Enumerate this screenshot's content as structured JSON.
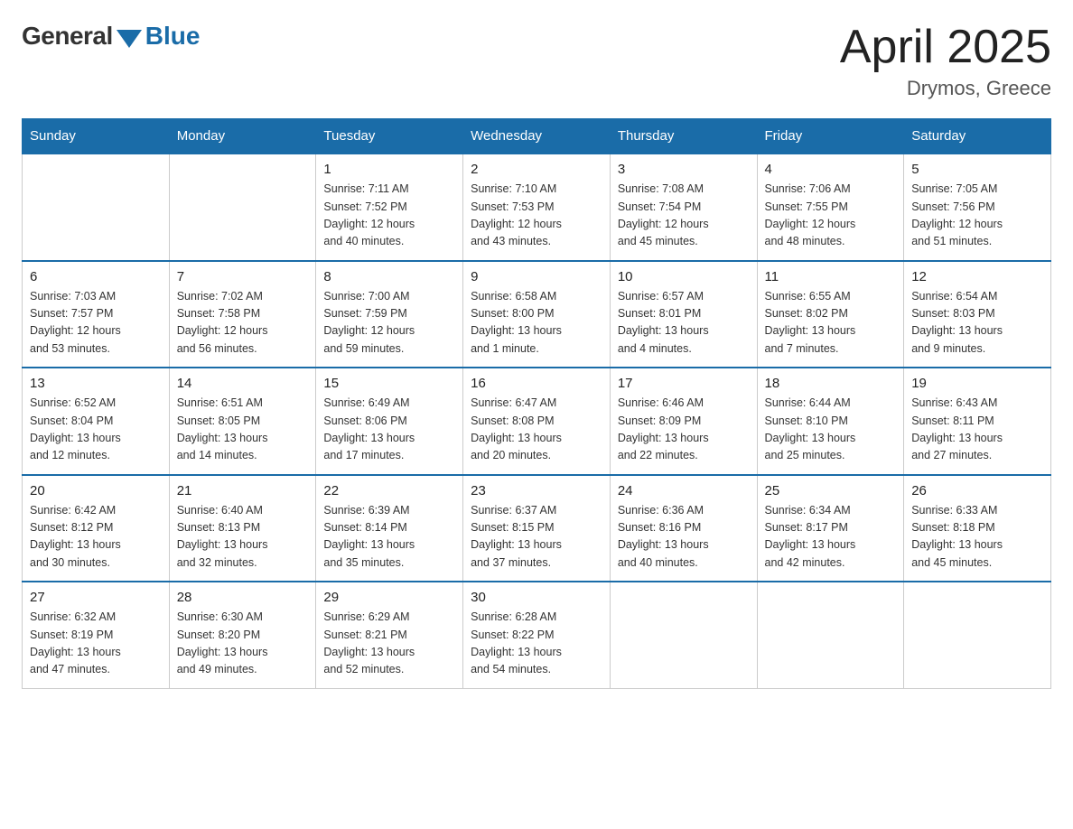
{
  "header": {
    "logo_general": "General",
    "logo_blue": "Blue",
    "month_title": "April 2025",
    "location": "Drymos, Greece"
  },
  "days_of_week": [
    "Sunday",
    "Monday",
    "Tuesday",
    "Wednesday",
    "Thursday",
    "Friday",
    "Saturday"
  ],
  "weeks": [
    [
      {
        "day": "",
        "info": ""
      },
      {
        "day": "",
        "info": ""
      },
      {
        "day": "1",
        "info": "Sunrise: 7:11 AM\nSunset: 7:52 PM\nDaylight: 12 hours\nand 40 minutes."
      },
      {
        "day": "2",
        "info": "Sunrise: 7:10 AM\nSunset: 7:53 PM\nDaylight: 12 hours\nand 43 minutes."
      },
      {
        "day": "3",
        "info": "Sunrise: 7:08 AM\nSunset: 7:54 PM\nDaylight: 12 hours\nand 45 minutes."
      },
      {
        "day": "4",
        "info": "Sunrise: 7:06 AM\nSunset: 7:55 PM\nDaylight: 12 hours\nand 48 minutes."
      },
      {
        "day": "5",
        "info": "Sunrise: 7:05 AM\nSunset: 7:56 PM\nDaylight: 12 hours\nand 51 minutes."
      }
    ],
    [
      {
        "day": "6",
        "info": "Sunrise: 7:03 AM\nSunset: 7:57 PM\nDaylight: 12 hours\nand 53 minutes."
      },
      {
        "day": "7",
        "info": "Sunrise: 7:02 AM\nSunset: 7:58 PM\nDaylight: 12 hours\nand 56 minutes."
      },
      {
        "day": "8",
        "info": "Sunrise: 7:00 AM\nSunset: 7:59 PM\nDaylight: 12 hours\nand 59 minutes."
      },
      {
        "day": "9",
        "info": "Sunrise: 6:58 AM\nSunset: 8:00 PM\nDaylight: 13 hours\nand 1 minute."
      },
      {
        "day": "10",
        "info": "Sunrise: 6:57 AM\nSunset: 8:01 PM\nDaylight: 13 hours\nand 4 minutes."
      },
      {
        "day": "11",
        "info": "Sunrise: 6:55 AM\nSunset: 8:02 PM\nDaylight: 13 hours\nand 7 minutes."
      },
      {
        "day": "12",
        "info": "Sunrise: 6:54 AM\nSunset: 8:03 PM\nDaylight: 13 hours\nand 9 minutes."
      }
    ],
    [
      {
        "day": "13",
        "info": "Sunrise: 6:52 AM\nSunset: 8:04 PM\nDaylight: 13 hours\nand 12 minutes."
      },
      {
        "day": "14",
        "info": "Sunrise: 6:51 AM\nSunset: 8:05 PM\nDaylight: 13 hours\nand 14 minutes."
      },
      {
        "day": "15",
        "info": "Sunrise: 6:49 AM\nSunset: 8:06 PM\nDaylight: 13 hours\nand 17 minutes."
      },
      {
        "day": "16",
        "info": "Sunrise: 6:47 AM\nSunset: 8:08 PM\nDaylight: 13 hours\nand 20 minutes."
      },
      {
        "day": "17",
        "info": "Sunrise: 6:46 AM\nSunset: 8:09 PM\nDaylight: 13 hours\nand 22 minutes."
      },
      {
        "day": "18",
        "info": "Sunrise: 6:44 AM\nSunset: 8:10 PM\nDaylight: 13 hours\nand 25 minutes."
      },
      {
        "day": "19",
        "info": "Sunrise: 6:43 AM\nSunset: 8:11 PM\nDaylight: 13 hours\nand 27 minutes."
      }
    ],
    [
      {
        "day": "20",
        "info": "Sunrise: 6:42 AM\nSunset: 8:12 PM\nDaylight: 13 hours\nand 30 minutes."
      },
      {
        "day": "21",
        "info": "Sunrise: 6:40 AM\nSunset: 8:13 PM\nDaylight: 13 hours\nand 32 minutes."
      },
      {
        "day": "22",
        "info": "Sunrise: 6:39 AM\nSunset: 8:14 PM\nDaylight: 13 hours\nand 35 minutes."
      },
      {
        "day": "23",
        "info": "Sunrise: 6:37 AM\nSunset: 8:15 PM\nDaylight: 13 hours\nand 37 minutes."
      },
      {
        "day": "24",
        "info": "Sunrise: 6:36 AM\nSunset: 8:16 PM\nDaylight: 13 hours\nand 40 minutes."
      },
      {
        "day": "25",
        "info": "Sunrise: 6:34 AM\nSunset: 8:17 PM\nDaylight: 13 hours\nand 42 minutes."
      },
      {
        "day": "26",
        "info": "Sunrise: 6:33 AM\nSunset: 8:18 PM\nDaylight: 13 hours\nand 45 minutes."
      }
    ],
    [
      {
        "day": "27",
        "info": "Sunrise: 6:32 AM\nSunset: 8:19 PM\nDaylight: 13 hours\nand 47 minutes."
      },
      {
        "day": "28",
        "info": "Sunrise: 6:30 AM\nSunset: 8:20 PM\nDaylight: 13 hours\nand 49 minutes."
      },
      {
        "day": "29",
        "info": "Sunrise: 6:29 AM\nSunset: 8:21 PM\nDaylight: 13 hours\nand 52 minutes."
      },
      {
        "day": "30",
        "info": "Sunrise: 6:28 AM\nSunset: 8:22 PM\nDaylight: 13 hours\nand 54 minutes."
      },
      {
        "day": "",
        "info": ""
      },
      {
        "day": "",
        "info": ""
      },
      {
        "day": "",
        "info": ""
      }
    ]
  ]
}
